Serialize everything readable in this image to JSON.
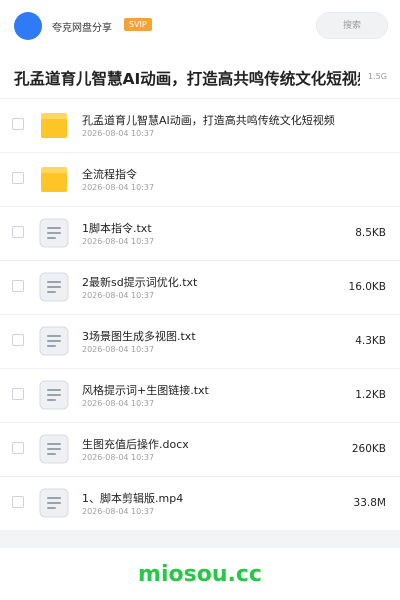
{
  "header": {
    "site_name": "夸克网盘分享",
    "badge": "SVIP",
    "search_placeholder": "搜索"
  },
  "share": {
    "title": "孔孟道育儿智慧AI动画，打造高共鸣传统文化短视频",
    "total_size": "1.5G"
  },
  "files": [
    {
      "name": "孔孟道育儿智慧AI动画，打造高共鸣传统文化短视频",
      "date": "2026-08-04 10:37",
      "size": "",
      "type": "folder"
    },
    {
      "name": "全流程指令",
      "date": "2026-08-04 10:37",
      "size": "",
      "type": "folder"
    },
    {
      "name": "1脚本指令.txt",
      "date": "2026-08-04 10:37",
      "size": "8.5KB",
      "type": "doc"
    },
    {
      "name": "2最新sd提示词优化.txt",
      "date": "2026-08-04 10:37",
      "size": "16.0KB",
      "type": "doc"
    },
    {
      "name": "3场景图生成多视图.txt",
      "date": "2026-08-04 10:37",
      "size": "4.3KB",
      "type": "doc"
    },
    {
      "name": "风格提示词+生图链接.txt",
      "date": "2026-08-04 10:37",
      "size": "1.2KB",
      "type": "doc"
    },
    {
      "name": "生图充值后操作.docx",
      "date": "2026-08-04 10:37",
      "size": "260KB",
      "type": "doc"
    },
    {
      "name": "1、脚本剪辑版.mp4",
      "date": "2026-08-04 10:37",
      "size": "33.8M",
      "type": "doc"
    }
  ],
  "colors": {
    "folder": "#ffc526",
    "folder_tab": "#ffd65e",
    "doc_bg": "#eef0f4",
    "doc_lines": "#9aa2b0",
    "accent": "#2f7bf5",
    "badge": "#f5a23c",
    "watermark": "#28c745"
  },
  "watermark": "miosou.cc"
}
